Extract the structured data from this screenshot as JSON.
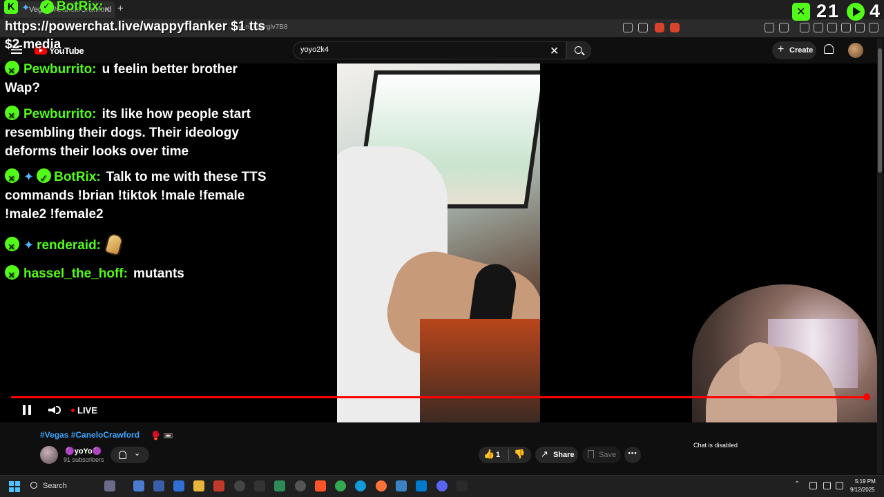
{
  "browser": {
    "tab_title": "Vegas #CaneloCrawford",
    "tab_close": "×",
    "new_tab": "+",
    "url_tail": "v=n1GGrglv7B8"
  },
  "youtube": {
    "logo": "YouTube",
    "search_value": "yoyo2k4",
    "clear_glyph": "✕",
    "create_label": "Create",
    "create_plus": "+"
  },
  "player": {
    "live_label": "LIVE"
  },
  "overlay": {
    "header_author": "BotRix:",
    "sword_glyph": "✦",
    "promo_text": "https://powerchat.live/wappyflanker $1 tts $2 media",
    "viewers_kick": "21",
    "viewers_yt": "4",
    "messages": [
      {
        "name": "Pewburrito:",
        "text": "u feelin better brother Wap?"
      },
      {
        "name": "Pewburrito:",
        "text": "its like how people start resembling their dogs. Their ideology deforms their looks over time"
      },
      {
        "name": "BotRix:",
        "text": "Talk to me with these TTS commands !brian !tiktok !male !female !male2 !female2"
      },
      {
        "name": "renderaid:",
        "text": ""
      },
      {
        "name": "hassel_the_hoff:",
        "text": "mutants"
      }
    ]
  },
  "below_player": {
    "title": "#Vegas #CaneloCrawford",
    "title_emojis": "🥊 📼",
    "channel_name": "🟣yoYo🟣",
    "subscribers": "91 subscribers",
    "bell_chevron": "⌄",
    "like_icon": "👍",
    "like_count": "1",
    "dislike_icon": "👎",
    "share_icon": "↗",
    "share_label": "Share",
    "save_label": "Save",
    "more_icon": "⋯",
    "chat_disabled": "Chat is disabled"
  },
  "taskbar": {
    "search_label": "Search",
    "tray_arrow": "⌃",
    "time": "5:19 PM",
    "date": "9/12/2025"
  },
  "colors": {
    "kick_green": "#53fc18",
    "yt_red": "#ff0000",
    "link_blue": "#3ea6ff"
  }
}
